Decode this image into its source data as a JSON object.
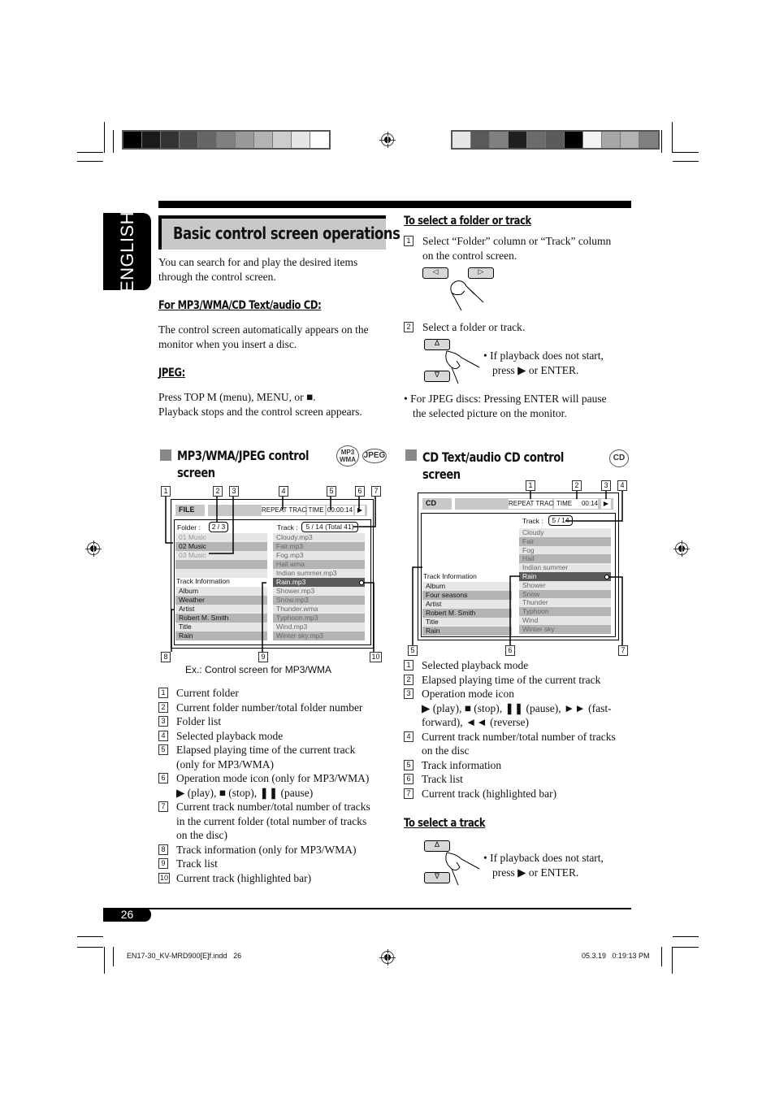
{
  "sidebar_tab": {
    "label": "ENGLISH"
  },
  "header": {
    "title": "Basic control screen operations"
  },
  "intro": {
    "line1": "You can search for and play the desired items",
    "line2": "through the control screen."
  },
  "mp3_cd_section": {
    "heading": "For MP3/WMA/CD Text/audio CD:",
    "line1": "The control screen automatically appears on the",
    "line2": "monitor when you insert a disc."
  },
  "jpeg_section": {
    "heading": "JPEG:",
    "line1": "Press TOP M (menu), MENU, or ■.",
    "line2": "Playback stops and the control screen appears."
  },
  "select_folder_track": {
    "heading": "To select a folder or track",
    "step1_num": "1",
    "step1_line1": "Select “Folder” column or “Track” column",
    "step1_line2": "on the control screen.",
    "left_button": "◁",
    "right_button": "▷",
    "step2_num": "2",
    "step2_text": "Select a folder or track.",
    "up_button": "∆",
    "down_button": "∇",
    "note_line1": "•  If playback does not start,",
    "note_line2": "press ▶ or ENTER.",
    "jpeg_note_line1": "•  For JPEG discs: Pressing ENTER will pause",
    "jpeg_note_line2": "the selected picture on the monitor."
  },
  "mp3_screen_section": {
    "title_line1": "MP3/WMA/JPEG control",
    "title_line2": "screen",
    "badges": [
      "MP3 WMA",
      "JPEG"
    ],
    "callouts": [
      "1",
      "2",
      "3",
      "4",
      "5",
      "6",
      "7",
      "8",
      "9",
      "10"
    ],
    "screen": {
      "source": "FILE",
      "mode": "REPEAT TRACK",
      "time_label": "TIME",
      "time": "00:00:14",
      "op_icon": "▶",
      "folder_label": "Folder :",
      "folder_count": "2 / 3",
      "track_label": "Track :",
      "track_count": "5 / 14 (Total 41)",
      "folders": [
        "01 Music",
        "02 Music",
        "03 Music",
        "",
        ""
      ],
      "current_folder_index": 1,
      "track_info_label": "Track Information",
      "track_info": [
        "Album",
        "Weather",
        "Artist",
        "Robert M. Smith",
        "Title",
        "Rain"
      ],
      "tracks": [
        "Cloudy.mp3",
        "Fair.mp3",
        "Fog.mp3",
        "Hail.wma",
        "Indian summer.mp3",
        "Rain.mp3",
        "Shower.mp3",
        "Snow.mp3",
        "Thunder.wma",
        "Typhoon.mp3",
        "Wind.mp3",
        "Winter sky.mp3"
      ],
      "current_track_index": 5
    },
    "caption": "Ex.: Control screen for MP3/WMA",
    "legend": [
      {
        "num": "1",
        "lines": [
          "Current folder"
        ]
      },
      {
        "num": "2",
        "lines": [
          "Current folder number/total folder number"
        ]
      },
      {
        "num": "3",
        "lines": [
          "Folder list"
        ]
      },
      {
        "num": "4",
        "lines": [
          "Selected playback mode"
        ]
      },
      {
        "num": "5",
        "lines": [
          "Elapsed playing time of the current track",
          "(only for MP3/WMA)"
        ]
      },
      {
        "num": "6",
        "lines": [
          "Operation mode icon (only for MP3/WMA)",
          "▶ (play), ■ (stop), ❚❚ (pause)"
        ]
      },
      {
        "num": "7",
        "lines": [
          "Current track number/total number of tracks",
          "in the current folder (total number of tracks",
          "on the disc)"
        ]
      },
      {
        "num": "8",
        "lines": [
          "Track information (only for MP3/WMA)"
        ]
      },
      {
        "num": "9",
        "lines": [
          "Track list"
        ]
      },
      {
        "num": "10",
        "lines": [
          "Current track (highlighted bar)"
        ]
      }
    ]
  },
  "cd_screen_section": {
    "title_line1": "CD Text/audio CD control",
    "title_line2": "screen",
    "badge": "CD",
    "callouts": [
      "1",
      "2",
      "3",
      "4",
      "5",
      "6",
      "7"
    ],
    "screen": {
      "source": "CD",
      "mode": "REPEAT TRACK",
      "time_label": "TIME",
      "time": "00:14",
      "op_icon": "▶",
      "track_label": "Track :",
      "track_count": "5 / 14",
      "track_info_label": "Track Information",
      "track_info": [
        "Album",
        "Four seasons",
        "Artist",
        "Robert M. Smith",
        "Title",
        "Rain"
      ],
      "tracks": [
        "Cloudy",
        "Fair",
        "Fog",
        "Hail",
        "Indian summer",
        "Rain",
        "Shower",
        "Snow",
        "Thunder",
        "Typhoon",
        "Wind",
        "Winter sky"
      ],
      "current_track_index": 5
    },
    "legend": [
      {
        "num": "1",
        "lines": [
          "Selected playback mode"
        ]
      },
      {
        "num": "2",
        "lines": [
          "Elapsed playing time of the current track"
        ]
      },
      {
        "num": "3",
        "lines": [
          "Operation mode icon",
          "▶ (play), ■ (stop), ❚❚ (pause), ►► (fast-",
          "forward), ◄◄ (reverse)"
        ]
      },
      {
        "num": "4",
        "lines": [
          "Current track number/total number of tracks",
          "on the disc"
        ]
      },
      {
        "num": "5",
        "lines": [
          "Track information"
        ]
      },
      {
        "num": "6",
        "lines": [
          "Track list"
        ]
      },
      {
        "num": "7",
        "lines": [
          "Current track (highlighted bar)"
        ]
      }
    ]
  },
  "select_track": {
    "heading": "To select a track",
    "up_button": "∆",
    "down_button": "∇",
    "note_line1": "•  If playback does not start,",
    "note_line2": "press ▶ or ENTER."
  },
  "footer": {
    "page_number": "26",
    "file_name": "EN17-30_KV-MRD900[E]f.indd   26",
    "timestamp": "05.3.19   0:19:13 PM"
  },
  "colors": {
    "title_bg": "#c8c8c8",
    "row_light": "#e6e6e6",
    "row_dark": "#b4b4b4",
    "row_selected": "#5a5a5a",
    "section_square": "#888888"
  },
  "color_bar_left": [
    "#000000",
    "#1a1a1a",
    "#333333",
    "#4d4d4d",
    "#666666",
    "#808080",
    "#999999",
    "#b3b3b3",
    "#cccccc",
    "#e6e6e6",
    "#ffffff"
  ],
  "color_bar_right": [
    "#e6e6e6",
    "#595959",
    "#808080",
    "#1f1f1f",
    "#6b6b6b",
    "#5a5a5a",
    "#000000",
    "#f2f2f2",
    "#a6a6a6",
    "#b3b3b3",
    "#808080"
  ]
}
